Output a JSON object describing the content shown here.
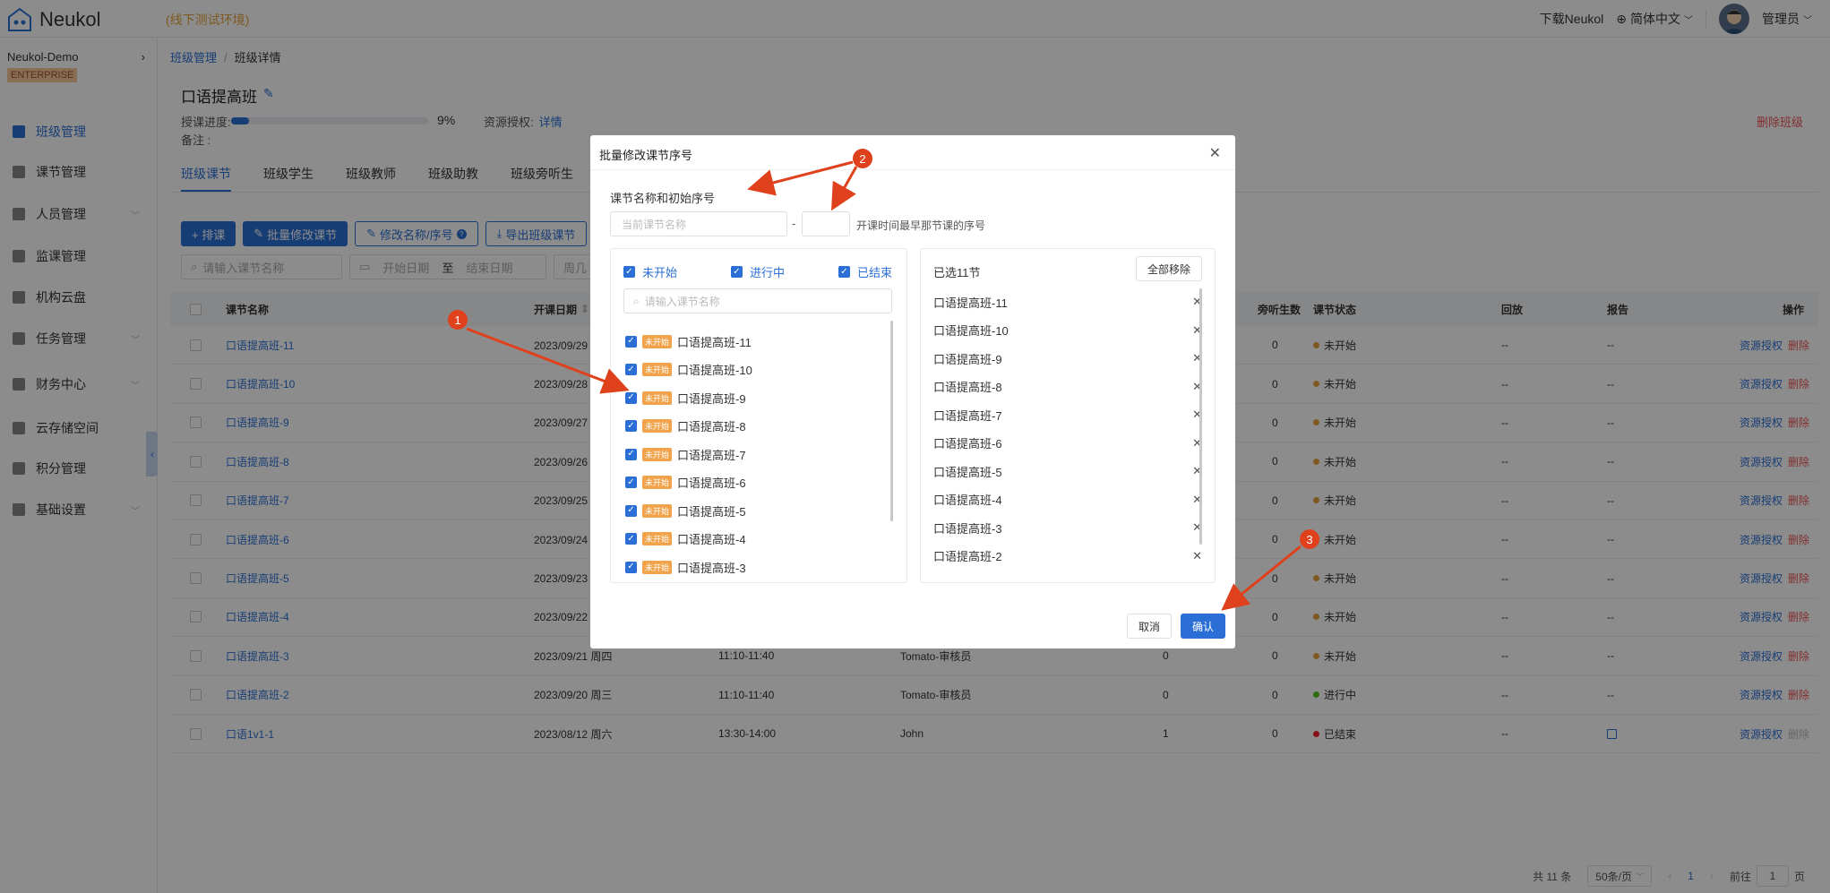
{
  "app": {
    "name": "Neukol",
    "env": "(线下测试环境)"
  },
  "topbar": {
    "download": "下载Neukol",
    "language": "简体中文",
    "user": "管理员"
  },
  "sidebar": {
    "org": "Neukol-Demo",
    "edition": "ENTERPRISE",
    "items": [
      {
        "label": "班级管理"
      },
      {
        "label": "课节管理"
      },
      {
        "label": "人员管理"
      },
      {
        "label": "监课管理"
      },
      {
        "label": "机构云盘"
      },
      {
        "label": "任务管理"
      },
      {
        "label": "财务中心"
      },
      {
        "label": "云存储空间"
      },
      {
        "label": "积分管理"
      },
      {
        "label": "基础设置"
      }
    ]
  },
  "breadcrumb": {
    "root": "班级管理",
    "sep": "/",
    "current": "班级详情"
  },
  "classInfo": {
    "title": "口语提高班",
    "progress_label": "授课进度:",
    "progress": 9,
    "progress_text": "9%",
    "resource_label": "资源授权:",
    "resource_link": "详情",
    "remark_label": "备注 :",
    "delete": "删除班级"
  },
  "tabs": [
    "班级课节",
    "班级学生",
    "班级教师",
    "班级助教",
    "班级旁听生"
  ],
  "toolbar": {
    "schedule": "+ 排课",
    "batch_edit": "批量修改课节",
    "rename": "修改名称/序号",
    "export": "导出班级课节"
  },
  "filters": {
    "search": "请输入课节名称",
    "start": "开始日期",
    "to": "至",
    "end": "结束日期",
    "weekday": "周几"
  },
  "table": {
    "headers": {
      "name": "课节名称",
      "date": "开课日期",
      "audit": "旁听生数",
      "status": "课节状态",
      "replay": "回放",
      "report": "报告",
      "action": "操作"
    },
    "rows": [
      {
        "name": "口语提高班-11",
        "date": "2023/09/29 周五",
        "time": "",
        "teacher": "",
        "students": "",
        "audit": "0",
        "status": "未开始",
        "replay": "--",
        "report": "--"
      },
      {
        "name": "口语提高班-10",
        "date": "2023/09/28 周四",
        "time": "",
        "teacher": "",
        "students": "",
        "audit": "0",
        "status": "未开始",
        "replay": "--",
        "report": "--"
      },
      {
        "name": "口语提高班-9",
        "date": "2023/09/27 周三",
        "time": "",
        "teacher": "",
        "students": "",
        "audit": "0",
        "status": "未开始",
        "replay": "--",
        "report": "--"
      },
      {
        "name": "口语提高班-8",
        "date": "2023/09/26 周二",
        "time": "",
        "teacher": "",
        "students": "",
        "audit": "0",
        "status": "未开始",
        "replay": "--",
        "report": "--"
      },
      {
        "name": "口语提高班-7",
        "date": "2023/09/25 周一",
        "time": "",
        "teacher": "",
        "students": "",
        "audit": "0",
        "status": "未开始",
        "replay": "--",
        "report": "--"
      },
      {
        "name": "口语提高班-6",
        "date": "2023/09/24 周日",
        "time": "",
        "teacher": "",
        "students": "",
        "audit": "0",
        "status": "未开始",
        "replay": "--",
        "report": "--"
      },
      {
        "name": "口语提高班-5",
        "date": "2023/09/23 周六",
        "time": "",
        "teacher": "",
        "students": "",
        "audit": "0",
        "status": "未开始",
        "replay": "--",
        "report": "--"
      },
      {
        "name": "口语提高班-4",
        "date": "2023/09/22 周五",
        "time": "",
        "teacher": "",
        "students": "",
        "audit": "0",
        "status": "未开始",
        "replay": "--",
        "report": "--"
      },
      {
        "name": "口语提高班-3",
        "date": "2023/09/21 周四",
        "time": "11:10-11:40",
        "teacher": "Tomato-审核员",
        "students": "0",
        "audit": "0",
        "status": "未开始",
        "replay": "--",
        "report": "--"
      },
      {
        "name": "口语提高班-2",
        "date": "2023/09/20 周三",
        "time": "11:10-11:40",
        "teacher": "Tomato-审核员",
        "students": "0",
        "audit": "0",
        "status": "进行中",
        "replay": "--",
        "report": "--"
      },
      {
        "name": "口语1v1-1",
        "date": "2023/08/12 周六",
        "time": "13:30-14:00",
        "teacher": "John",
        "students": "1",
        "audit": "0",
        "status": "已结束",
        "replay": "--",
        "report": ""
      }
    ],
    "action_auth": "资源授权",
    "action_delete": "删除"
  },
  "pager": {
    "total": "共 11 条",
    "size": "50条/页",
    "page": "1",
    "goto": "前往",
    "goto_value": "1",
    "goto_unit": "页"
  },
  "modal": {
    "title": "批量修改课节序号",
    "seq_label": "课节名称和初始序号",
    "name_placeholder": "当前课节名称",
    "dash": "-",
    "hint": "开课时间最早那节课的序号",
    "filters": [
      "未开始",
      "进行中",
      "已结束"
    ],
    "search_placeholder": "请输入课节名称",
    "tag": "未开始",
    "lessons": [
      "口语提高班-11",
      "口语提高班-10",
      "口语提高班-9",
      "口语提高班-8",
      "口语提高班-7",
      "口语提高班-6",
      "口语提高班-5",
      "口语提高班-4",
      "口语提高班-3"
    ],
    "selected_count": "已选11节",
    "remove_all": "全部移除",
    "selected": [
      "口语提高班-11",
      "口语提高班-10",
      "口语提高班-9",
      "口语提高班-8",
      "口语提高班-7",
      "口语提高班-6",
      "口语提高班-5",
      "口语提高班-4",
      "口语提高班-3",
      "口语提高班-2"
    ],
    "cancel": "取消",
    "ok": "确认"
  },
  "annotations": [
    "1",
    "2",
    "3"
  ],
  "colors": {
    "primary": "#2b6fd6",
    "danger": "#e55555",
    "warning": "#e6a23c",
    "annotation": "#e0411d"
  }
}
